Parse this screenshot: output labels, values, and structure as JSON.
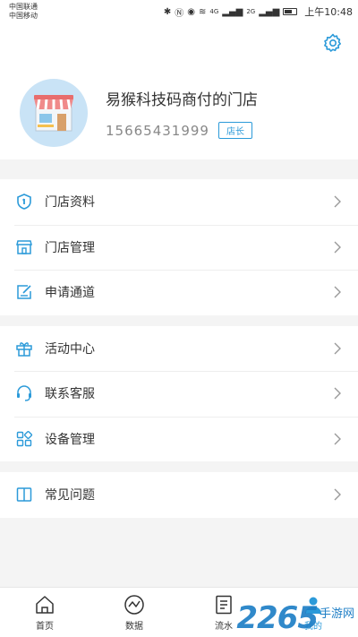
{
  "status_bar": {
    "carrier_1": "中国联通",
    "carrier_2": "中国移动",
    "net_4g": "4G",
    "net_2g": "2G",
    "time": "上午10:48"
  },
  "store": {
    "name": "易猴科技码商付的门店",
    "phone": "15665431999",
    "role": "店长"
  },
  "menu_groups": [
    [
      {
        "label": "门店资料",
        "icon": "shield-icon"
      },
      {
        "label": "门店管理",
        "icon": "store-icon"
      },
      {
        "label": "申请通道",
        "icon": "edit-icon"
      }
    ],
    [
      {
        "label": "活动中心",
        "icon": "gift-icon"
      },
      {
        "label": "联系客服",
        "icon": "headset-icon"
      },
      {
        "label": "设备管理",
        "icon": "apps-icon"
      }
    ],
    [
      {
        "label": "常见问题",
        "icon": "book-icon"
      }
    ]
  ],
  "tabs": [
    {
      "label": "首页",
      "icon": "home-icon",
      "active": false
    },
    {
      "label": "数据",
      "icon": "chart-icon",
      "active": false
    },
    {
      "label": "流水",
      "icon": "list-icon",
      "active": false
    },
    {
      "label": "我的",
      "icon": "user-icon",
      "active": true
    }
  ],
  "watermark": {
    "number": "2265",
    "text": "手游网"
  },
  "colors": {
    "accent": "#2b9ad9",
    "background": "#f4f4f4"
  }
}
